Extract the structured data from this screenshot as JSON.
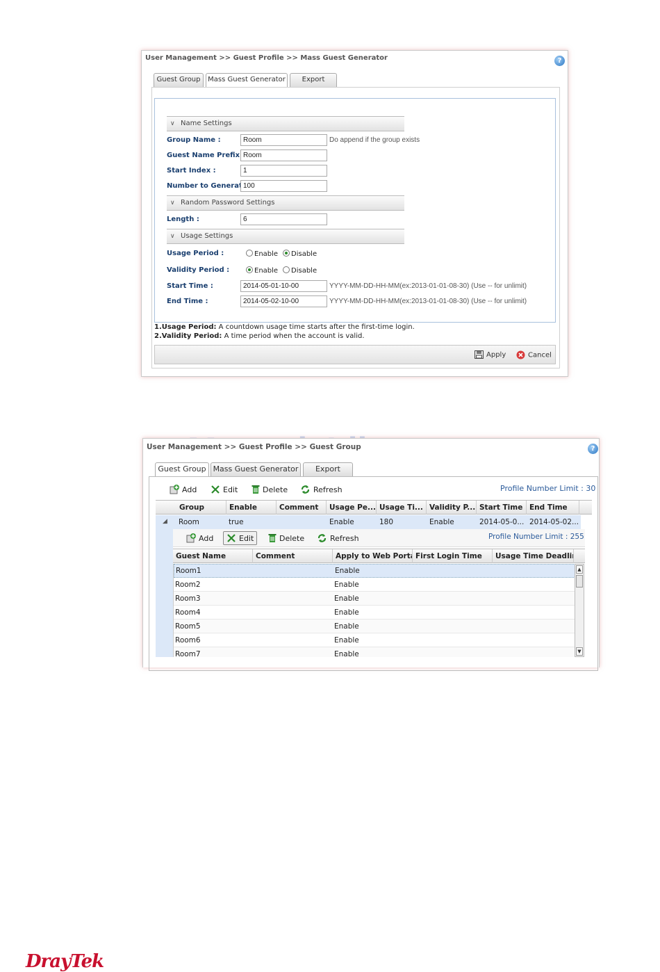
{
  "panel1": {
    "breadcrumb": "User Management >> Guest Profile >> Mass Guest Generator",
    "tabs": [
      "Guest Group",
      "Mass Guest Generator",
      "Export"
    ],
    "sections": {
      "name": "Name Settings",
      "password": "Random Password Settings",
      "usage": "Usage Settings"
    },
    "fields": {
      "group_name": {
        "label": "Group Name :",
        "value": "Room",
        "hint": "Do append if the group exists"
      },
      "prefix": {
        "label": "Guest Name Prefix :",
        "value": "Room"
      },
      "start_index": {
        "label": "Start Index :",
        "value": "1"
      },
      "number": {
        "label": "Number to Generate :",
        "value": "100"
      },
      "length": {
        "label": "Length :",
        "value": "6"
      },
      "usage_period": {
        "label": "Usage Period :",
        "options": [
          "Enable",
          "Disable"
        ],
        "selected": "Disable"
      },
      "validity_period": {
        "label": "Validity Period :",
        "options": [
          "Enable",
          "Disable"
        ],
        "selected": "Enable"
      },
      "start_time": {
        "label": "Start Time :",
        "value": "2014-05-01-10-00",
        "hint": "YYYY-MM-DD-HH-MM(ex:2013-01-01-08-30) (Use -- for unlimit)"
      },
      "end_time": {
        "label": "End Time :",
        "value": "2014-05-02-10-00",
        "hint": "YYYY-MM-DD-HH-MM(ex:2013-01-01-08-30) (Use -- for unlimit)"
      }
    },
    "notes": [
      {
        "bold": "1.Usage Period:",
        "text": " A countdown usage time starts after the first-time login."
      },
      {
        "bold": "2.Validity Period:",
        "text": " A time period when the account is valid."
      }
    ],
    "buttons": {
      "apply": "Apply",
      "cancel": "Cancel"
    }
  },
  "panel2": {
    "breadcrumb": "User Management >> Guest Profile >> Guest Group",
    "tabs": [
      "Guest Group",
      "Mass Guest Generator",
      "Export"
    ],
    "toolbar": {
      "add": "Add",
      "edit": "Edit",
      "delete": "Delete",
      "refresh": "Refresh"
    },
    "profile_limit": "Profile Number Limit :  30",
    "group_columns": [
      "Group",
      "Enable",
      "Comment",
      "Usage Pe...",
      "Usage Ti...",
      "Validity P...",
      "Start Time",
      "End Time"
    ],
    "group_row": [
      "Room",
      "true",
      "",
      "Enable",
      "180",
      "Enable",
      "2014-05-0...",
      "2014-05-02..."
    ],
    "sub_toolbar": {
      "add": "Add",
      "edit": "Edit",
      "delete": "Delete",
      "refresh": "Refresh"
    },
    "sub_limit": "Profile Number Limit :  255",
    "guest_columns": [
      "Guest Name",
      "Comment",
      "Apply to Web Portal",
      "First Login Time",
      "Usage Time Deadline"
    ],
    "guests": [
      [
        "Room1",
        "",
        "Enable",
        "",
        ""
      ],
      [
        "Room2",
        "",
        "Enable",
        "",
        ""
      ],
      [
        "Room3",
        "",
        "Enable",
        "",
        ""
      ],
      [
        "Room4",
        "",
        "Enable",
        "",
        ""
      ],
      [
        "Room5",
        "",
        "Enable",
        "",
        ""
      ],
      [
        "Room6",
        "",
        "Enable",
        "",
        ""
      ],
      [
        "Room7",
        "",
        "Enable",
        "",
        ""
      ]
    ]
  },
  "watermark": "ManualsLib.com",
  "logo": "DrayTek",
  "colors": {
    "brand": "#c8102e",
    "link_blue": "#1a3f6f",
    "selection": "#dce8f8"
  }
}
